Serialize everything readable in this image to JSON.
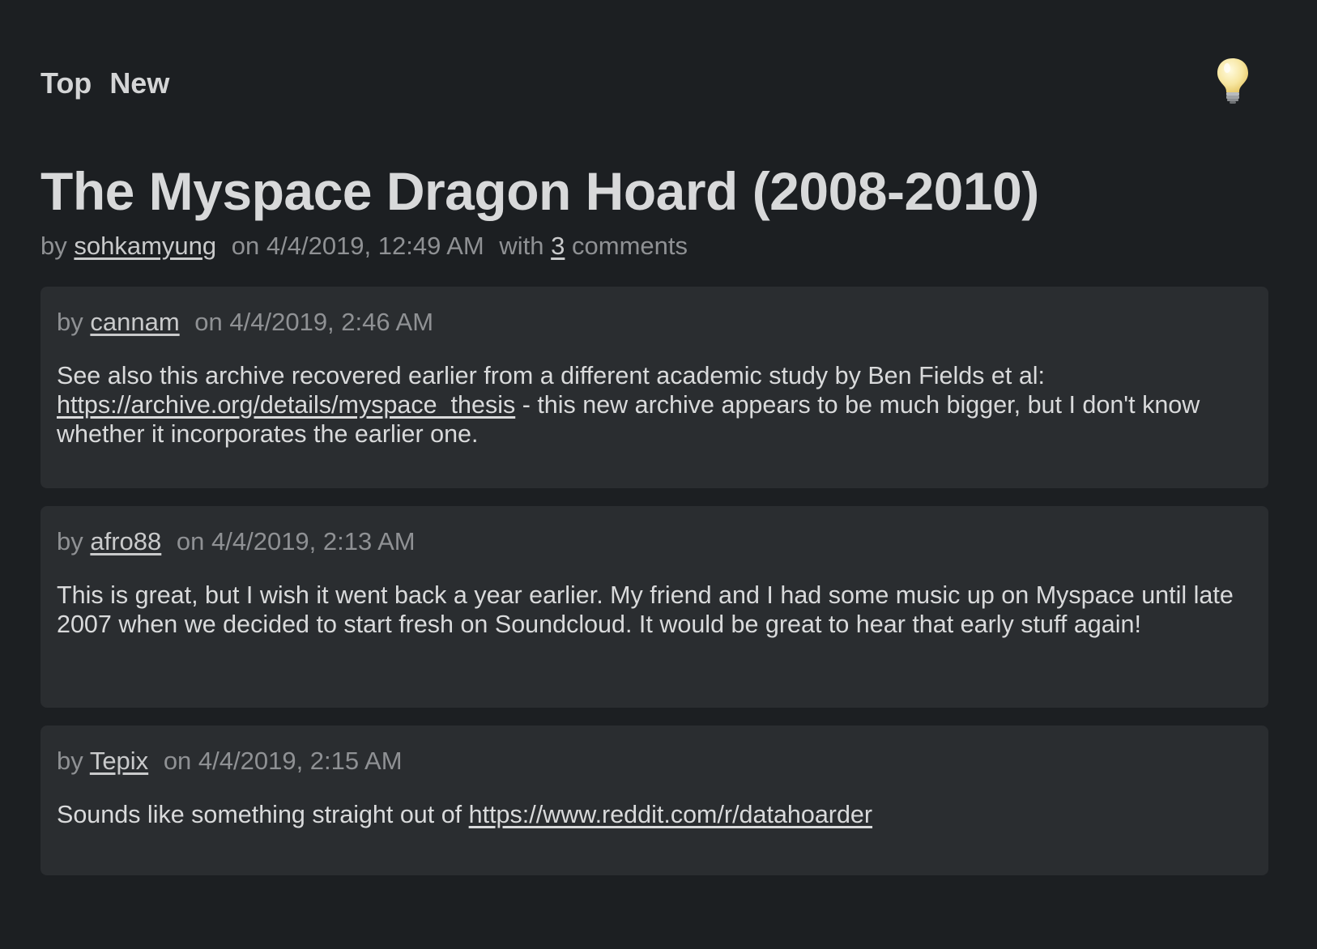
{
  "nav": {
    "top_label": "Top",
    "new_label": "New"
  },
  "theme_toggle": {
    "icon": "lightbulb-icon"
  },
  "story": {
    "title": "The Myspace Dragon Hoard (2008-2010)",
    "by_prefix": "by",
    "author": "sohkamyung",
    "date_text": "on 4/4/2019, 12:49 AM",
    "with_prefix": "with",
    "comment_count": "3",
    "comments_suffix": "comments"
  },
  "comments": [
    {
      "by_prefix": "by",
      "author": "cannam",
      "date_text": "on 4/4/2019, 2:46 AM",
      "text_before": "See also this archive recovered earlier from a different academic study by Ben Fields et al: ",
      "link": "https://archive.org/details/myspace_thesis",
      "text_after": " - this new archive appears to be much bigger, but I don't know whether it incorporates the earlier one."
    },
    {
      "by_prefix": "by",
      "author": "afro88",
      "date_text": "on 4/4/2019, 2:13 AM",
      "text": "This is great, but I wish it went back a year earlier. My friend and I had some music up on Myspace until late 2007 when we decided to start fresh on Soundcloud. It would be great to hear that early stuff again!"
    },
    {
      "by_prefix": "by",
      "author": "Tepix",
      "date_text": "on 4/4/2019, 2:15 AM",
      "text_before": "Sounds like something straight out of ",
      "link": "https://www.reddit.com/r/datahoarder"
    }
  ],
  "colors": {
    "background": "#1c1f22",
    "card": "#2a2d30",
    "text": "#d9dadb",
    "muted": "#8f9194"
  }
}
